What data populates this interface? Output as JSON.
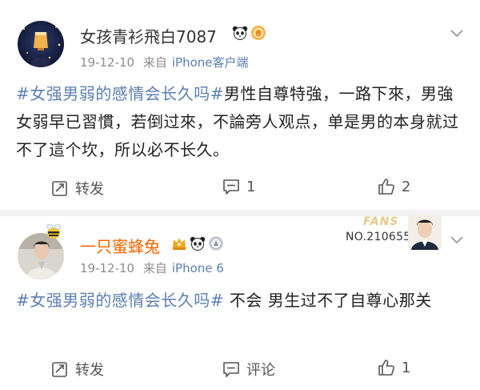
{
  "posts": [
    {
      "username": "女孩青衫飛白7087",
      "badge_icons": [
        "panda-icon",
        "medal-icon"
      ],
      "time": "19-12-10",
      "source_prefix": "来自",
      "source": "iPhone客户端",
      "topic": "#女强男弱的感情会长久吗#",
      "text": "男性自尊特強，一路下來，男強女弱早已習慣，若倒过來，不論旁人观点，单是男的本身就过不了這个坎，所以必不长久。",
      "repost_label": "转发",
      "comment_label": "1",
      "like_label": "2"
    },
    {
      "username": "一只蜜蜂兔",
      "badge_icons": [
        "crown-badge-icon",
        "panda-icon",
        "level-medal-icon"
      ],
      "time": "19-12-10",
      "source_prefix": "来自",
      "source": "iPhone 6",
      "topic": "#女强男弱的感情会长久吗#",
      "text": " 不会 男生过不了自尊心那关",
      "repost_label": "转发",
      "comment_label": "评论",
      "like_label": "1",
      "fans_card": {
        "word": "FANS",
        "number": "NO.210655"
      }
    }
  ],
  "colors": {
    "topic": "#5b7fb0",
    "vip_name": "#f86400",
    "meta": "#8c8c8c"
  }
}
